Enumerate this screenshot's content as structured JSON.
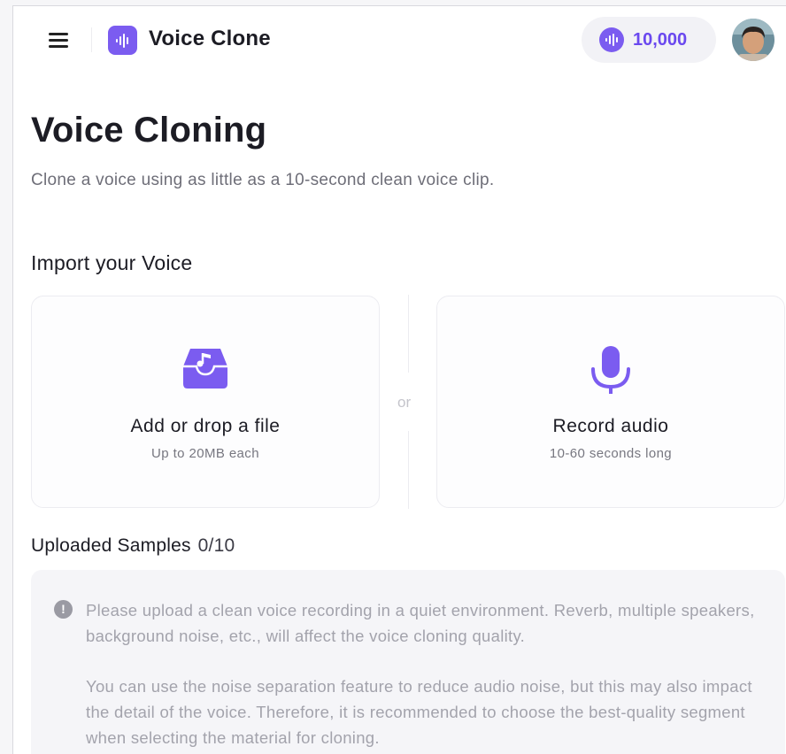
{
  "header": {
    "app_title": "Voice Clone",
    "credits": "10,000",
    "menu_icon": "hamburger-menu-icon",
    "logo_icon": "waveform-logo-icon",
    "credits_icon": "waveform-coin-icon"
  },
  "main": {
    "title": "Voice Cloning",
    "subtitle": "Clone a voice using as little as a 10-second clean voice clip.",
    "import_title": "Import your Voice",
    "upload_card": {
      "title": "Add or drop a file",
      "subtitle": "Up to 20MB each",
      "icon": "music-inbox-icon"
    },
    "or_label": "or",
    "record_card": {
      "title": "Record audio",
      "subtitle": "10-60 seconds long",
      "icon": "microphone-icon"
    },
    "samples_label": "Uploaded Samples",
    "samples_count": "0/10",
    "notice": {
      "icon": "info-icon",
      "para1": "Please upload a clean voice recording in a quiet environment. Reverb, multiple speakers, background noise, etc., will affect the voice cloning quality.",
      "para2": "You can use the noise separation feature to reduce audio noise, but this may also impact the detail of the voice. Therefore, it is recommended to choose the best-quality segment when selecting the material for cloning."
    }
  },
  "colors": {
    "accent": "#7b5cf0",
    "credits_text": "#6a48ef",
    "muted_text": "#a3a3ac"
  }
}
